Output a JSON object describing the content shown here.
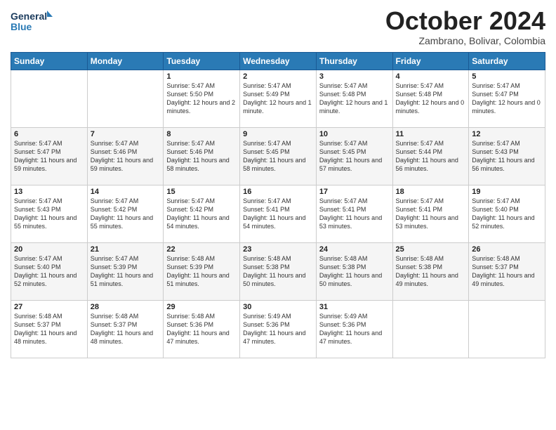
{
  "logo": {
    "line1": "General",
    "line2": "Blue"
  },
  "title": "October 2024",
  "subtitle": "Zambrano, Bolivar, Colombia",
  "header_days": [
    "Sunday",
    "Monday",
    "Tuesday",
    "Wednesday",
    "Thursday",
    "Friday",
    "Saturday"
  ],
  "weeks": [
    [
      {
        "day": "",
        "info": ""
      },
      {
        "day": "",
        "info": ""
      },
      {
        "day": "1",
        "info": "Sunrise: 5:47 AM\nSunset: 5:50 PM\nDaylight: 12 hours\nand 2 minutes."
      },
      {
        "day": "2",
        "info": "Sunrise: 5:47 AM\nSunset: 5:49 PM\nDaylight: 12 hours\nand 1 minute."
      },
      {
        "day": "3",
        "info": "Sunrise: 5:47 AM\nSunset: 5:48 PM\nDaylight: 12 hours\nand 1 minute."
      },
      {
        "day": "4",
        "info": "Sunrise: 5:47 AM\nSunset: 5:48 PM\nDaylight: 12 hours\nand 0 minutes."
      },
      {
        "day": "5",
        "info": "Sunrise: 5:47 AM\nSunset: 5:47 PM\nDaylight: 12 hours\nand 0 minutes."
      }
    ],
    [
      {
        "day": "6",
        "info": "Sunrise: 5:47 AM\nSunset: 5:47 PM\nDaylight: 11 hours\nand 59 minutes."
      },
      {
        "day": "7",
        "info": "Sunrise: 5:47 AM\nSunset: 5:46 PM\nDaylight: 11 hours\nand 59 minutes."
      },
      {
        "day": "8",
        "info": "Sunrise: 5:47 AM\nSunset: 5:46 PM\nDaylight: 11 hours\nand 58 minutes."
      },
      {
        "day": "9",
        "info": "Sunrise: 5:47 AM\nSunset: 5:45 PM\nDaylight: 11 hours\nand 58 minutes."
      },
      {
        "day": "10",
        "info": "Sunrise: 5:47 AM\nSunset: 5:45 PM\nDaylight: 11 hours\nand 57 minutes."
      },
      {
        "day": "11",
        "info": "Sunrise: 5:47 AM\nSunset: 5:44 PM\nDaylight: 11 hours\nand 56 minutes."
      },
      {
        "day": "12",
        "info": "Sunrise: 5:47 AM\nSunset: 5:43 PM\nDaylight: 11 hours\nand 56 minutes."
      }
    ],
    [
      {
        "day": "13",
        "info": "Sunrise: 5:47 AM\nSunset: 5:43 PM\nDaylight: 11 hours\nand 55 minutes."
      },
      {
        "day": "14",
        "info": "Sunrise: 5:47 AM\nSunset: 5:42 PM\nDaylight: 11 hours\nand 55 minutes."
      },
      {
        "day": "15",
        "info": "Sunrise: 5:47 AM\nSunset: 5:42 PM\nDaylight: 11 hours\nand 54 minutes."
      },
      {
        "day": "16",
        "info": "Sunrise: 5:47 AM\nSunset: 5:41 PM\nDaylight: 11 hours\nand 54 minutes."
      },
      {
        "day": "17",
        "info": "Sunrise: 5:47 AM\nSunset: 5:41 PM\nDaylight: 11 hours\nand 53 minutes."
      },
      {
        "day": "18",
        "info": "Sunrise: 5:47 AM\nSunset: 5:41 PM\nDaylight: 11 hours\nand 53 minutes."
      },
      {
        "day": "19",
        "info": "Sunrise: 5:47 AM\nSunset: 5:40 PM\nDaylight: 11 hours\nand 52 minutes."
      }
    ],
    [
      {
        "day": "20",
        "info": "Sunrise: 5:47 AM\nSunset: 5:40 PM\nDaylight: 11 hours\nand 52 minutes."
      },
      {
        "day": "21",
        "info": "Sunrise: 5:47 AM\nSunset: 5:39 PM\nDaylight: 11 hours\nand 51 minutes."
      },
      {
        "day": "22",
        "info": "Sunrise: 5:48 AM\nSunset: 5:39 PM\nDaylight: 11 hours\nand 51 minutes."
      },
      {
        "day": "23",
        "info": "Sunrise: 5:48 AM\nSunset: 5:38 PM\nDaylight: 11 hours\nand 50 minutes."
      },
      {
        "day": "24",
        "info": "Sunrise: 5:48 AM\nSunset: 5:38 PM\nDaylight: 11 hours\nand 50 minutes."
      },
      {
        "day": "25",
        "info": "Sunrise: 5:48 AM\nSunset: 5:38 PM\nDaylight: 11 hours\nand 49 minutes."
      },
      {
        "day": "26",
        "info": "Sunrise: 5:48 AM\nSunset: 5:37 PM\nDaylight: 11 hours\nand 49 minutes."
      }
    ],
    [
      {
        "day": "27",
        "info": "Sunrise: 5:48 AM\nSunset: 5:37 PM\nDaylight: 11 hours\nand 48 minutes."
      },
      {
        "day": "28",
        "info": "Sunrise: 5:48 AM\nSunset: 5:37 PM\nDaylight: 11 hours\nand 48 minutes."
      },
      {
        "day": "29",
        "info": "Sunrise: 5:48 AM\nSunset: 5:36 PM\nDaylight: 11 hours\nand 47 minutes."
      },
      {
        "day": "30",
        "info": "Sunrise: 5:49 AM\nSunset: 5:36 PM\nDaylight: 11 hours\nand 47 minutes."
      },
      {
        "day": "31",
        "info": "Sunrise: 5:49 AM\nSunset: 5:36 PM\nDaylight: 11 hours\nand 47 minutes."
      },
      {
        "day": "",
        "info": ""
      },
      {
        "day": "",
        "info": ""
      }
    ]
  ]
}
